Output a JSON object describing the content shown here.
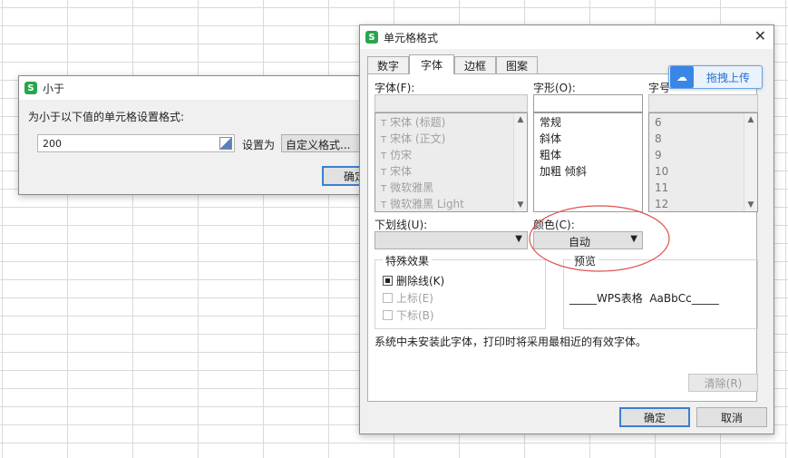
{
  "small_dialog": {
    "title": "小于",
    "app_badge": "S",
    "prompt": "为小于以下值的单元格设置格式:",
    "value": "200",
    "set_as_label": "设置为",
    "format_value": "自定义格式...",
    "ok_label": "确定"
  },
  "format_dialog": {
    "title": "单元格格式",
    "app_badge": "S",
    "tabs": [
      {
        "label": "数字"
      },
      {
        "label": "字体"
      },
      {
        "label": "边框"
      },
      {
        "label": "图案"
      }
    ],
    "upload_label": "拖拽上传",
    "font_label": "字体(F):",
    "style_label": "字形(O):",
    "size_label": "字号",
    "fonts": [
      {
        "name": "宋体 (标题)"
      },
      {
        "name": "宋体 (正文)"
      },
      {
        "name": "仿宋"
      },
      {
        "name": "宋体"
      },
      {
        "name": "微软雅黑"
      },
      {
        "name": "微软雅黑 Light"
      }
    ],
    "styles": [
      {
        "name": "常规"
      },
      {
        "name": "斜体"
      },
      {
        "name": "粗体"
      },
      {
        "name": "加粗 倾斜"
      }
    ],
    "sizes": [
      {
        "value": "6"
      },
      {
        "value": "8"
      },
      {
        "value": "9"
      },
      {
        "value": "10"
      },
      {
        "value": "11"
      },
      {
        "value": "12"
      }
    ],
    "underline_label": "下划线(U):",
    "color_label": "颜色(C):",
    "color_value": "自动",
    "effects_title": "特殊效果",
    "strikethrough_label": "删除线(K)",
    "superscript_label": "上标(E)",
    "subscript_label": "下标(B)",
    "preview_title": "预览",
    "preview_text": "_____WPS表格  AaBbCc_____",
    "note": "系统中未安装此字体，打印时将采用最相近的有效字体。",
    "clear_label": "清除(R)",
    "ok_label": "确定",
    "cancel_label": "取消"
  },
  "colors": {
    "accent_blue": "#3c7fd1",
    "wps_green": "#2aa54e",
    "annotation_red": "#d9534f"
  }
}
